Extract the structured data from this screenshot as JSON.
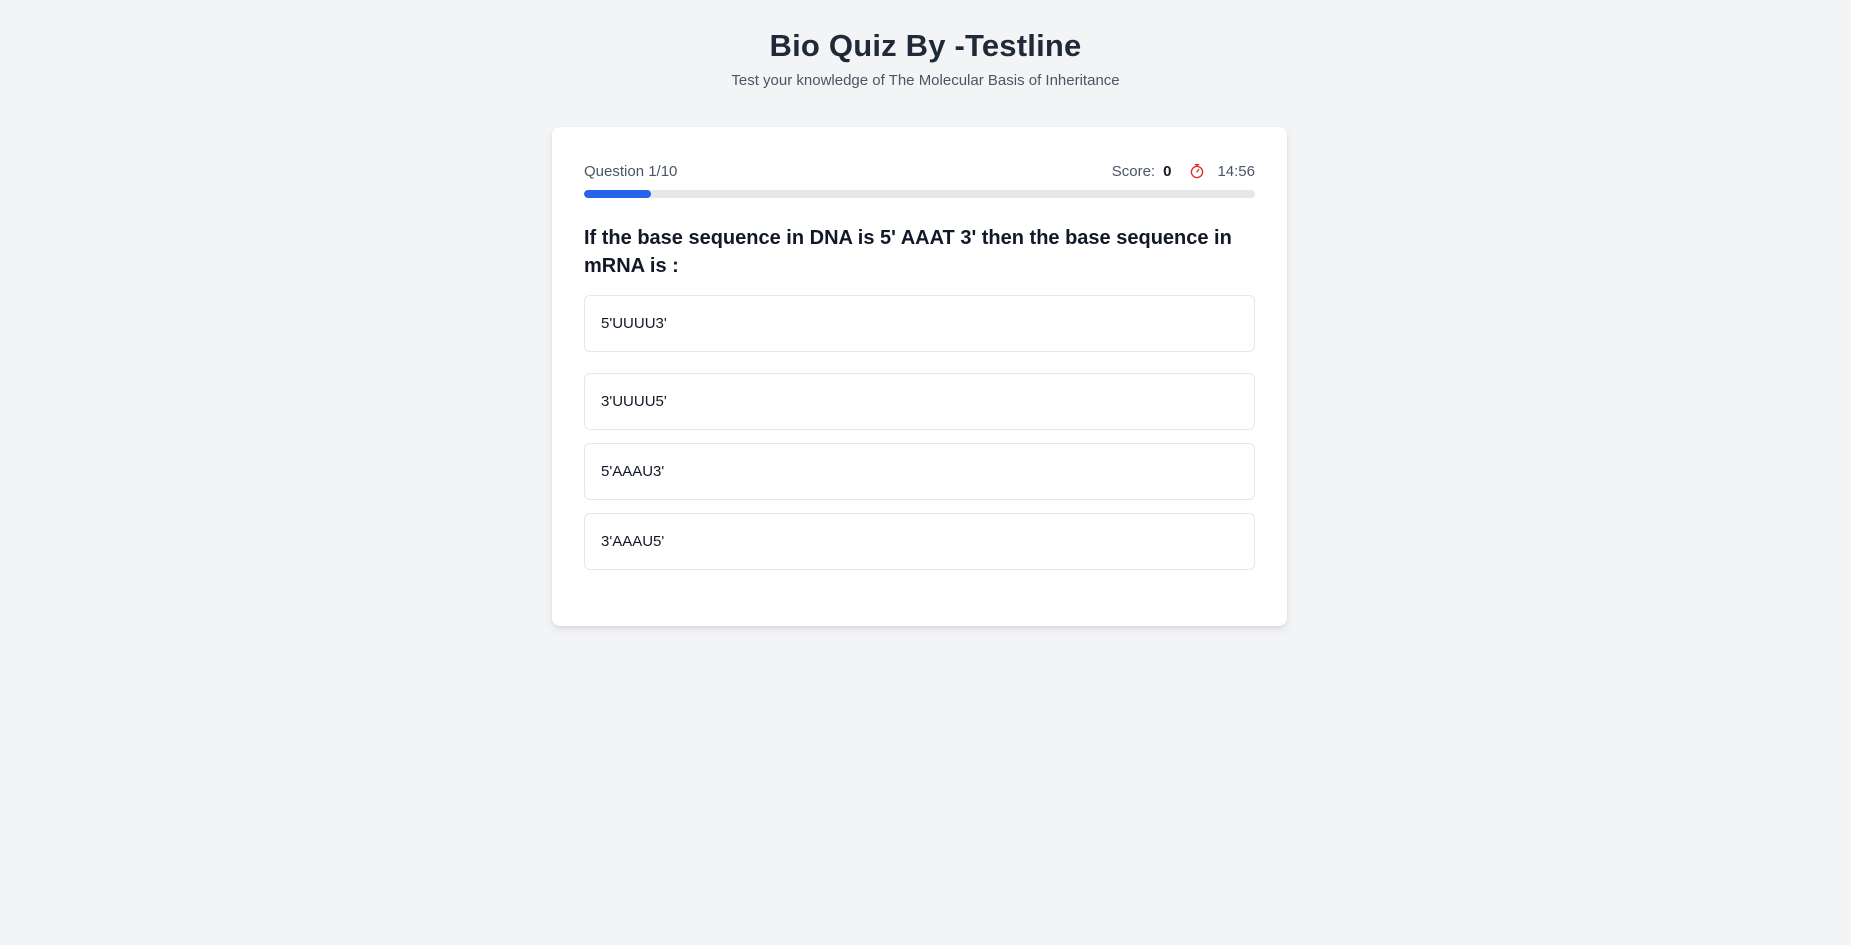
{
  "header": {
    "title": "Bio Quiz By -Testline",
    "subtitle": "Test your knowledge of The Molecular Basis of Inheritance"
  },
  "quiz": {
    "question_counter": "Question 1/10",
    "score_label": "Score:",
    "score_value": "0",
    "timer_icon": "stopwatch-icon",
    "timer": "14:56",
    "progress_fraction": 0.1,
    "question": "If the base sequence in DNA is 5' AAAT 3' then the base sequence in mRNA is :",
    "options": [
      "5'UUUU3'",
      "3'UUUU5'",
      "5'AAAU3'",
      "3'AAAU5'"
    ]
  },
  "colors": {
    "accent": "#2563eb",
    "background": "#f3f4f6",
    "timer_icon": "#dc2626"
  }
}
